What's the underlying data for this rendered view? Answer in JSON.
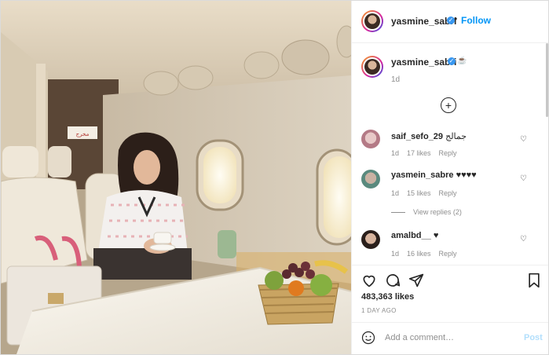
{
  "colors": {
    "accent": "#0095f6",
    "verified": "#3897f0",
    "muted": "#8e8e8e",
    "text": "#262626",
    "post_disabled": "#b2dffc"
  },
  "header": {
    "username": "yasmine_sabri",
    "separator": "•",
    "follow_label": "Follow"
  },
  "caption": {
    "username": "yasmine_sabri",
    "emoji": "☕",
    "time": "1d"
  },
  "load_more_icon": "plus-circle-icon",
  "comments": [
    {
      "username": "saif_sefo_29",
      "text": "جمالج",
      "time": "1d",
      "likes": "17 likes",
      "reply": "Reply"
    },
    {
      "username": "yasmein_sabre",
      "text": "♥♥♥♥",
      "time": "1d",
      "likes": "15 likes",
      "reply": "Reply"
    },
    {
      "username": "amalbd__",
      "text": "♥",
      "time": "1d",
      "likes": "16 likes",
      "reply": "Reply"
    }
  ],
  "view_replies": "View replies (2)",
  "actions": {
    "icons": [
      "heart-icon",
      "comment-icon",
      "share-icon",
      "bookmark-icon"
    ],
    "likes": "483,363 likes",
    "time_ago": "1 DAY AGO"
  },
  "add_comment": {
    "placeholder": "Add a comment…",
    "post_label": "Post"
  },
  "photo": {
    "sign_text": "مخرج"
  }
}
